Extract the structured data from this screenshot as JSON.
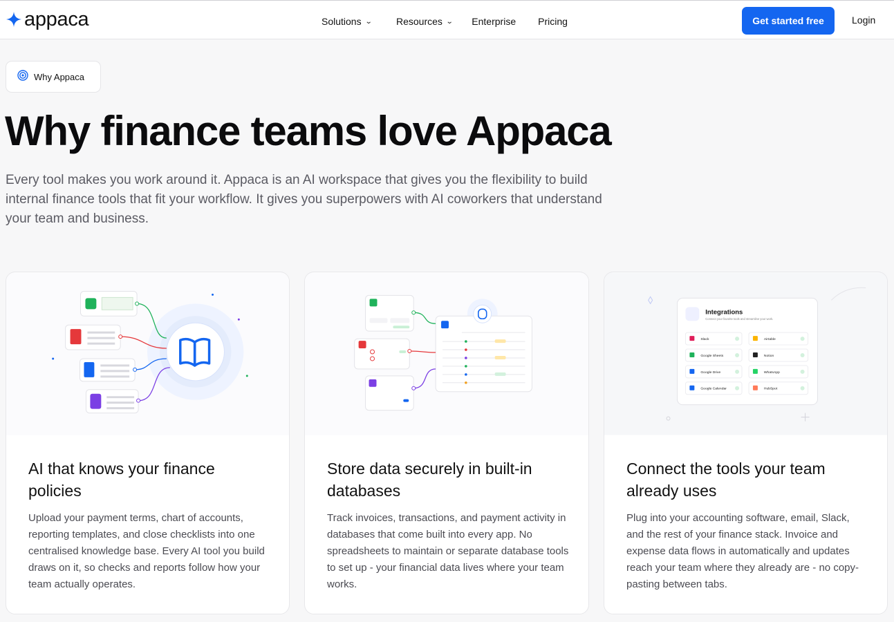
{
  "brand": {
    "name": "appaca",
    "logo_icon": "sparkle-icon",
    "accent": "#1466f0"
  },
  "nav": {
    "links": [
      {
        "label": "Solutions",
        "has_dropdown": true
      },
      {
        "label": "Resources",
        "has_dropdown": true
      },
      {
        "label": "Enterprise",
        "has_dropdown": false
      },
      {
        "label": "Pricing",
        "has_dropdown": false
      }
    ],
    "cta_label": "Get started free",
    "login_label": "Login"
  },
  "hero": {
    "badge_label": "Why Appaca",
    "badge_icon": "target-icon",
    "title": "Why finance teams love Appaca",
    "subtitle": "Every tool makes you work around it. Appaca is an AI workspace that gives you the flexibility to build internal finance tools that fit your workflow. It gives you superpowers with AI coworkers that understand your team and business."
  },
  "cards": [
    {
      "title": "AI that knows your finance policies",
      "body": "Upload your payment terms, chart of accounts, reporting templates, and close checklists into one centralised knowledge base. Every AI tool you build draws on it, so checks and reports follow how your team actually operates."
    },
    {
      "title": "Store data securely in built-in databases",
      "body": "Track invoices, transactions, and payment activity in databases that come built into every app. No spreadsheets to maintain or separate database tools to set up - your financial data lives where your team works."
    },
    {
      "title": "Connect the tools your team already uses",
      "body": "Plug into your accounting software, email, Slack, and the rest of your finance stack. Invoice and expense data flows in automatically and updates reach your team where they already are - no copy-pasting between tabs.",
      "integrations_panel": {
        "title": "Integrations",
        "subtitle": "Connect your favorite tools and streamline your work.",
        "items": [
          "Slack",
          "Airtable",
          "Google Sheets",
          "Notion",
          "Google Drive",
          "WhatsApp",
          "Google Calendar",
          "HubSpot"
        ]
      }
    }
  ]
}
